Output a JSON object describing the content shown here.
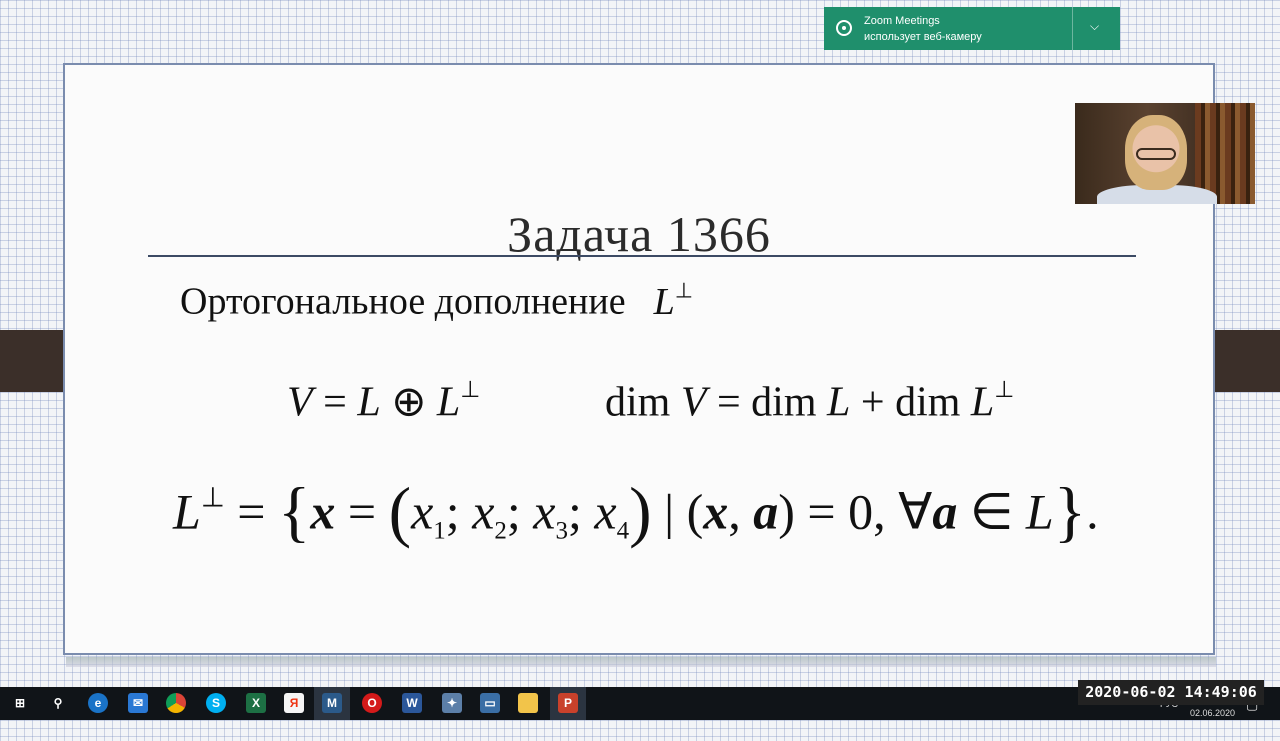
{
  "slide": {
    "title": "Задача 1366",
    "line1_text": "Ортогональное дополнение"
  },
  "notification": {
    "app_name": "Zoom Meetings",
    "message": "использует веб-камеру",
    "icon": "webcam-icon",
    "accent_color": "#1f8f6c"
  },
  "taskbar": {
    "icons": [
      "windows-start-icon",
      "search-icon",
      "edge-icon",
      "mail-icon",
      "chrome-icon",
      "skype-icon",
      "excel-icon",
      "yandex-icon",
      "maple-icon",
      "opera-icon",
      "word-icon",
      "network-icon",
      "window-icon",
      "folder-icon",
      "powerpoint-icon"
    ],
    "tray_lang": "РУС",
    "tray_date": "02.06.2020"
  },
  "overlay": {
    "timestamp": "2020-06-02 14:49:06"
  }
}
